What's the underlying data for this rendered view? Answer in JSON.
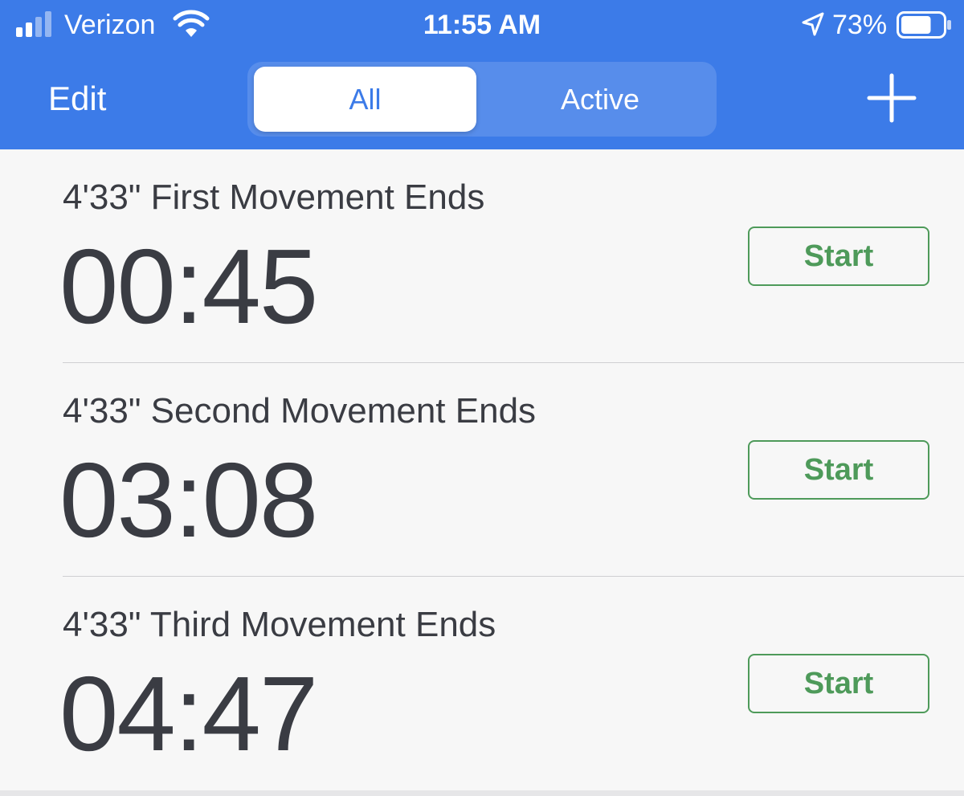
{
  "status_bar": {
    "carrier": "Verizon",
    "time": "11:55 AM",
    "battery_percent": "73%",
    "signal_bars_filled": 2,
    "signal_bars_total": 4,
    "battery_level": 0.73,
    "icons": [
      "cellular-signal-icon",
      "wifi-icon",
      "location-arrow-icon",
      "battery-icon"
    ]
  },
  "nav": {
    "edit_label": "Edit",
    "segments": [
      {
        "label": "All",
        "selected": true
      },
      {
        "label": "Active",
        "selected": false
      }
    ],
    "add_icon": "plus-icon"
  },
  "timers": [
    {
      "title": "4'33\" First Movement Ends",
      "time": "00:45",
      "button_label": "Start"
    },
    {
      "title": "4'33\" Second Movement Ends",
      "time": "03:08",
      "button_label": "Start"
    },
    {
      "title": "4'33\" Third Movement Ends",
      "time": "04:47",
      "button_label": "Start"
    }
  ],
  "colors": {
    "header_blue": "#3c7be8",
    "start_green": "#4e9a5a",
    "text_dark": "#3a3c43",
    "background": "#f7f7f7"
  }
}
